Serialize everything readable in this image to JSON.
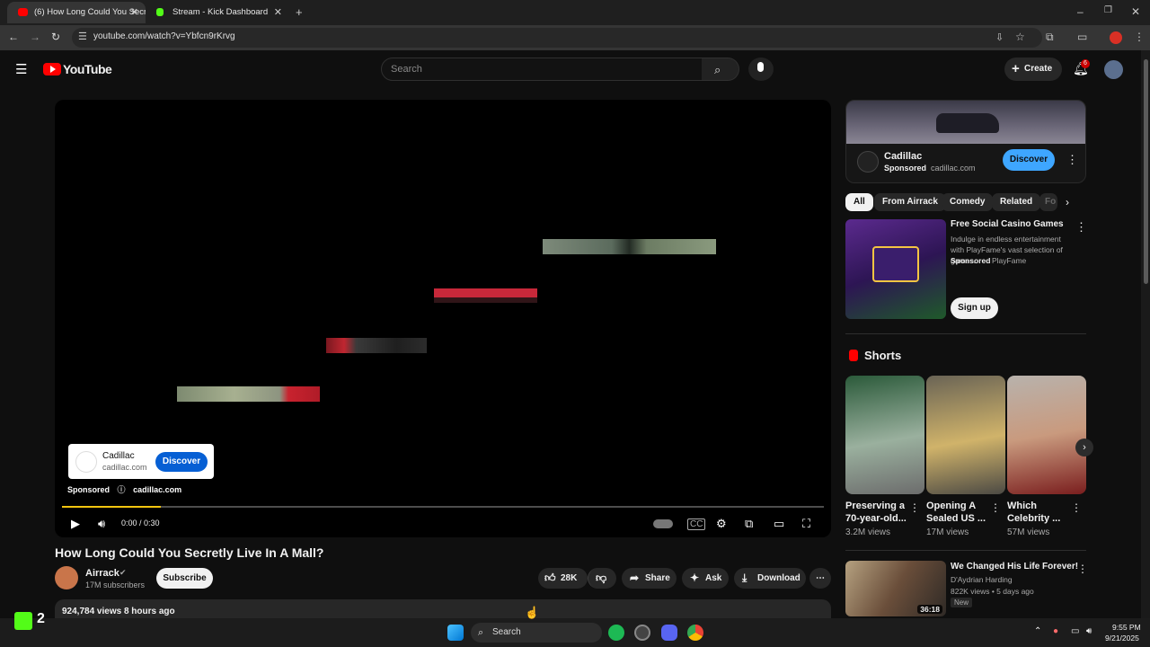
{
  "browser": {
    "tabs": [
      {
        "title": "(6) How Long Could You Secretl",
        "active": true
      },
      {
        "title": "Stream - Kick Dashboard",
        "active": false
      }
    ],
    "url": "youtube.com/watch?v=Ybfcn9rKrvg"
  },
  "header": {
    "logo": "YouTube",
    "search_placeholder": "Search",
    "create_label": "Create",
    "notification_count": "6"
  },
  "player": {
    "ad": {
      "name": "Cadillac",
      "domain": "cadillac.com",
      "button": "Discover",
      "sponsored": "Sponsored",
      "sponsored_domain": "cadillac.com"
    },
    "time": "0:00 / 0:30",
    "progress": 0.13
  },
  "video": {
    "title": "How Long Could You Secretly Live In A Mall?",
    "channel": "Airrack",
    "subscribers": "17M subscribers",
    "subscribe_label": "Subscribe",
    "likes": "28K",
    "share_label": "Share",
    "ask_label": "Ask",
    "download_label": "Download",
    "views_line": "924,784 views  8 hours ago"
  },
  "sidebar": {
    "ad": {
      "name": "Cadillac",
      "sponsored": "Sponsored",
      "domain": "cadillac.com",
      "button": "Discover"
    },
    "chips": [
      "All",
      "From Airrack",
      "Comedy",
      "Related",
      "Fo"
    ],
    "promo": {
      "title": "Free Social Casino Games",
      "desc": "Indulge in endless entertainment with PlayFame's vast selection of games.",
      "sponsored": "Sponsored",
      "advertiser": "PlayFame",
      "cta": "Sign up"
    },
    "shorts_heading": "Shorts",
    "shorts": [
      {
        "title": "Preserving a 70-year-old...",
        "views": "3.2M views"
      },
      {
        "title": "Opening A Sealed US ...",
        "views": "17M views"
      },
      {
        "title": "Which Celebrity ...",
        "views": "57M views"
      }
    ],
    "next_video": {
      "title": "We Changed His Life Forever!",
      "channel": "D'Aydrian Harding",
      "meta": "822K views • 5 days ago",
      "badge": "New",
      "duration": "36:18"
    }
  },
  "taskbar": {
    "search": "Search",
    "time": "9:55 PM",
    "date": "9/21/2025",
    "kick_count": "2"
  }
}
